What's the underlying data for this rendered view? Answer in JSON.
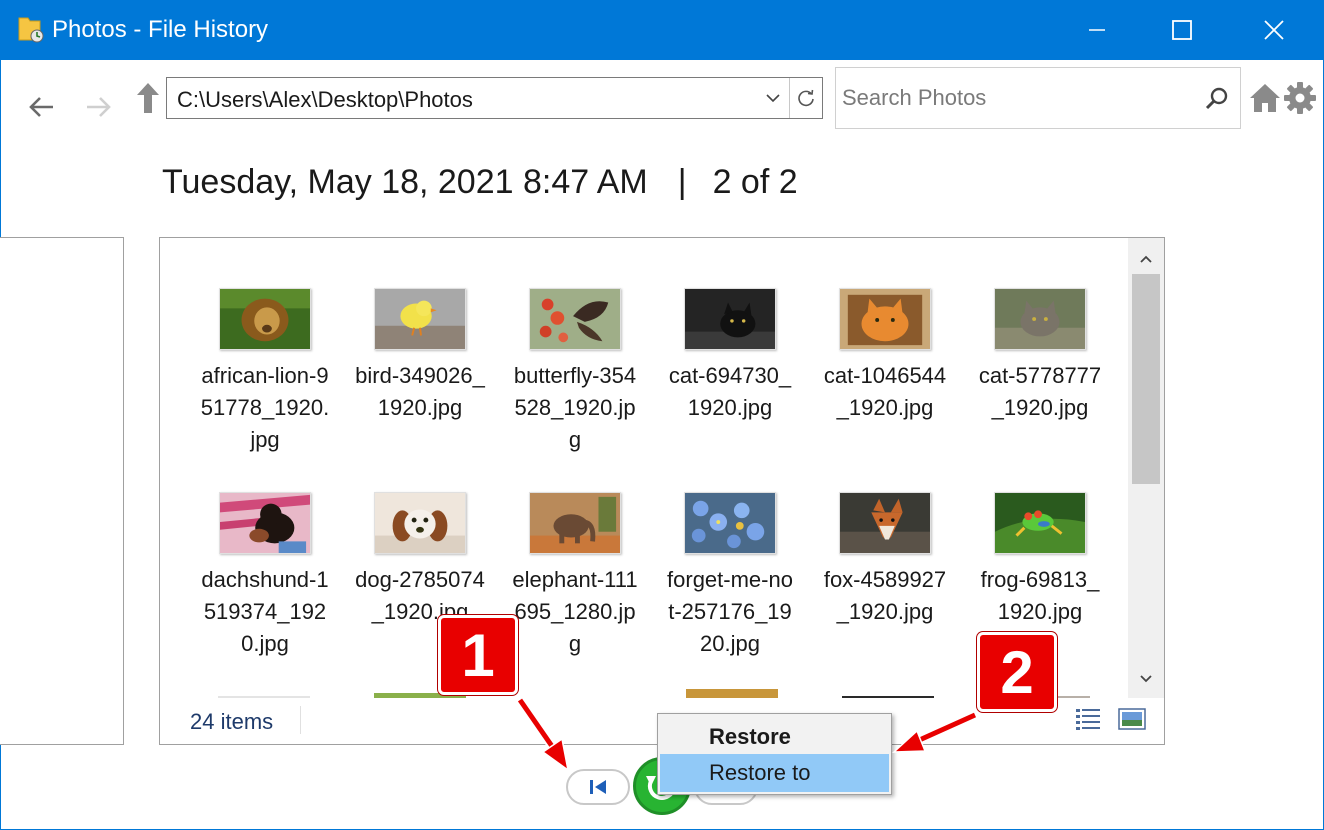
{
  "window": {
    "title": "Photos - File History",
    "title_bar_color": "#0078d7"
  },
  "nav": {
    "address": "C:\\Users\\Alex\\Desktop\\Photos",
    "search_placeholder": "Search Photos"
  },
  "heading": {
    "date": "Tuesday, May 18, 2021 8:47 AM",
    "separator": "|",
    "position": "2 of 2"
  },
  "files": [
    {
      "name": "african-lion-951778_1920.jpg",
      "thumb": "lion"
    },
    {
      "name": "bird-349026_1920.jpg",
      "thumb": "bird"
    },
    {
      "name": "butterfly-354528_1920.jpg",
      "thumb": "butterfly"
    },
    {
      "name": "cat-694730_1920.jpg",
      "thumb": "black-cat"
    },
    {
      "name": "cat-1046544_1920.jpg",
      "thumb": "orange-cat"
    },
    {
      "name": "cat-5778777_1920.jpg",
      "thumb": "grey-cat"
    },
    {
      "name": "dachshund-1519374_1920.jpg",
      "thumb": "dachshund"
    },
    {
      "name": "dog-2785074_1920.jpg",
      "thumb": "dog"
    },
    {
      "name": "elephant-111695_1280.jpg",
      "thumb": "elephant"
    },
    {
      "name": "forget-me-not-257176_1920.jpg",
      "thumb": "flowers"
    },
    {
      "name": "fox-4589927_1920.jpg",
      "thumb": "fox"
    },
    {
      "name": "frog-69813_1920.jpg",
      "thumb": "frog"
    }
  ],
  "status": {
    "item_count": "24 items"
  },
  "context_menu": {
    "items": [
      "Restore",
      "Restore to"
    ],
    "highlighted": "Restore to"
  },
  "callouts": [
    "1",
    "2"
  ],
  "colors": {
    "accent": "#0078d7",
    "restore_green": "#28b432",
    "callout_red": "#e80000",
    "menu_highlight": "#91c9f7"
  }
}
